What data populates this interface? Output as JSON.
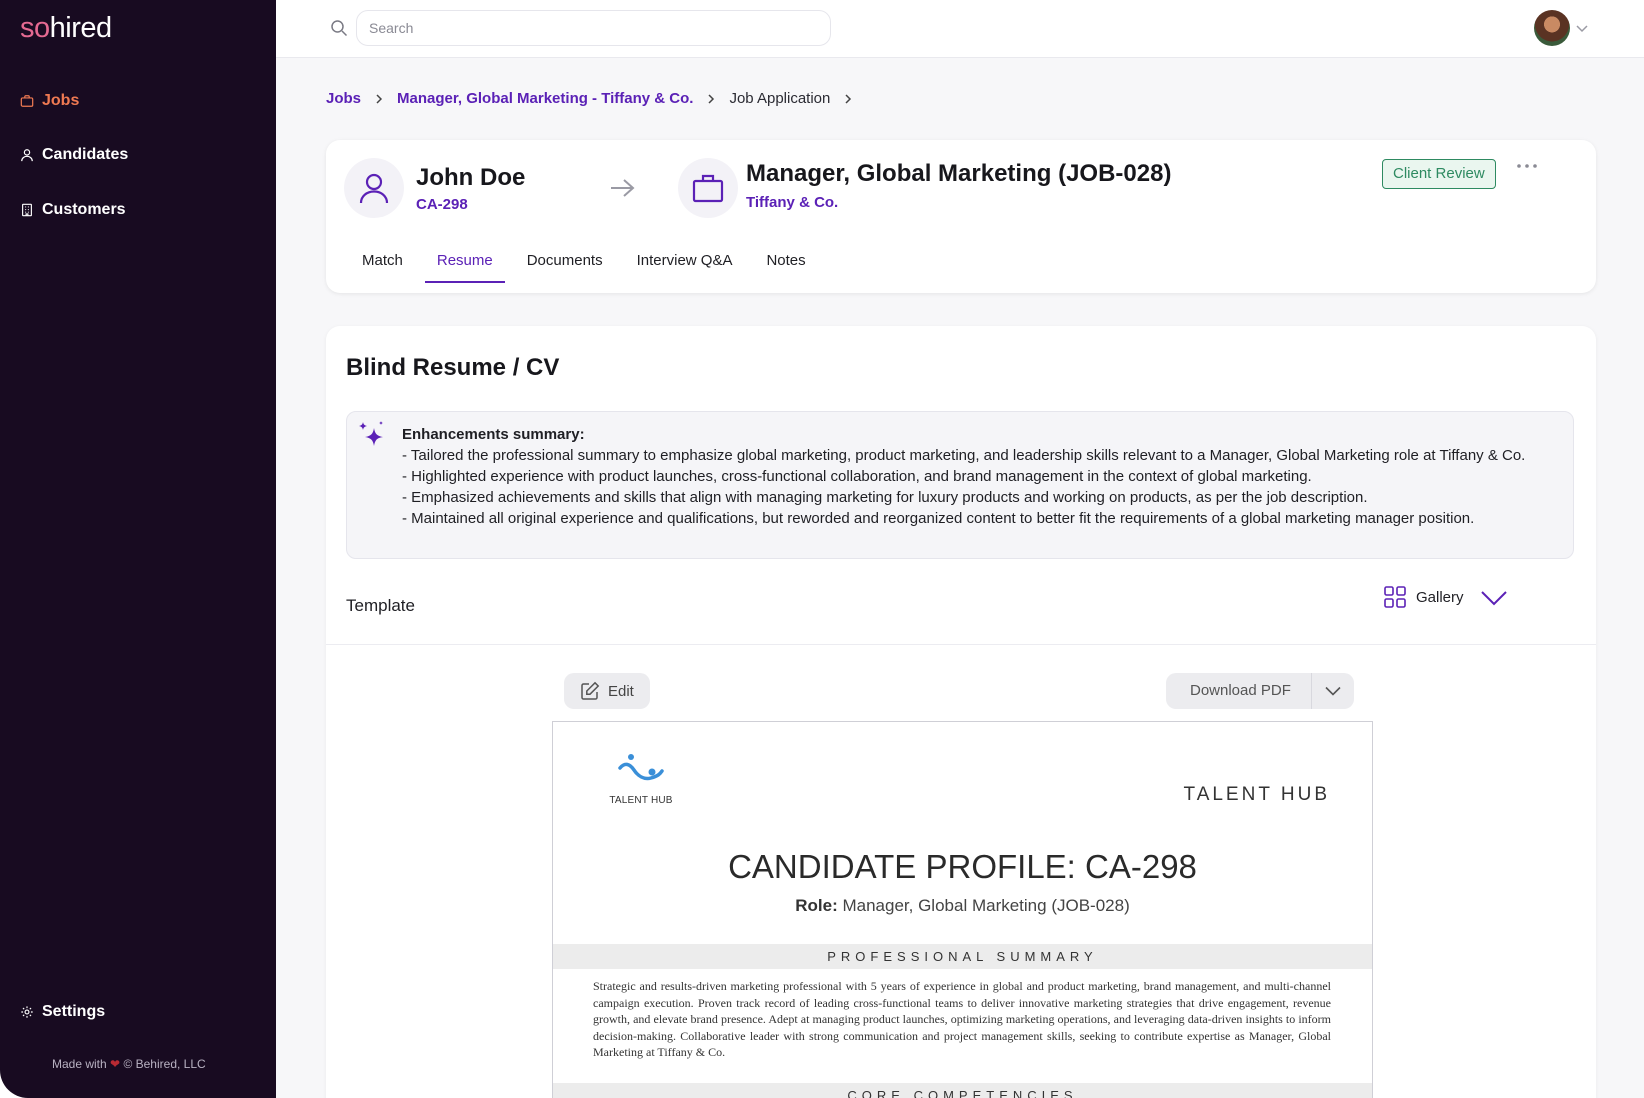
{
  "app": {
    "logo_so": "so",
    "logo_hired": "hired",
    "footer_prefix": "Made with",
    "footer_suffix": "© Behired, LLC"
  },
  "sidebar": {
    "items": [
      {
        "label": "Jobs",
        "icon": "briefcase-icon",
        "active": true
      },
      {
        "label": "Candidates",
        "icon": "user-icon"
      },
      {
        "label": "Customers",
        "icon": "building-icon"
      }
    ],
    "settings_label": "Settings"
  },
  "search": {
    "placeholder": "Search"
  },
  "breadcrumb": [
    "Jobs",
    "Manager, Global Marketing - Tiffany & Co.",
    "Job Application"
  ],
  "candidate": {
    "name": "John Doe",
    "id": "CA-298"
  },
  "job": {
    "title": "Manager, Global Marketing (JOB-028)",
    "company": "Tiffany & Co.",
    "status": "Client Review"
  },
  "tabs": [
    "Match",
    "Resume",
    "Documents",
    "Interview Q&A",
    "Notes"
  ],
  "active_tab": "Resume",
  "resume_section": {
    "title": "Blind Resume / CV",
    "summary_heading": "Enhancements summary:",
    "summary_lines": [
      "- Tailored the professional summary to emphasize global marketing, product marketing, and leadership skills relevant to a Manager, Global Marketing role at Tiffany & Co.",
      "- Highlighted experience with product launches, cross-functional collaboration, and brand management in the context of global marketing.",
      "- Emphasized achievements and skills that align with managing marketing for luxury products and working on products, as per the job description.",
      "- Maintained all original experience and qualifications, but reworded and reorganized content to better fit the requirements of a global marketing manager position."
    ],
    "template_label": "Template",
    "gallery_label": "Gallery",
    "edit_label": "Edit",
    "download_label": "Download PDF"
  },
  "resume_doc": {
    "logo_text": "TALENT HUB",
    "brand": "TALENT HUB",
    "title": "CANDIDATE PROFILE: CA-298",
    "role_label": "Role:",
    "role_value": "Manager, Global Marketing (JOB-028)",
    "summary_heading": "PROFESSIONAL SUMMARY",
    "summary_text": "Strategic and results-driven marketing professional with 5 years of experience in global and product marketing, brand management, and multi-channel campaign execution. Proven track record of leading cross-functional teams to deliver innovative marketing strategies that drive engagement, revenue growth, and elevate brand presence. Adept at managing product launches, optimizing marketing operations, and leveraging data-driven insights to inform decision-making. Collaborative leader with strong communication and project management skills, seeking to contribute expertise as Manager, Global Marketing at Tiffany & Co.",
    "next_heading": "CORE COMPETENCIES"
  },
  "colors": {
    "accent": "#5b21b6",
    "active_nav": "#ef7a52",
    "sidebar_bg": "#180b21",
    "status": "#2e8a61"
  }
}
